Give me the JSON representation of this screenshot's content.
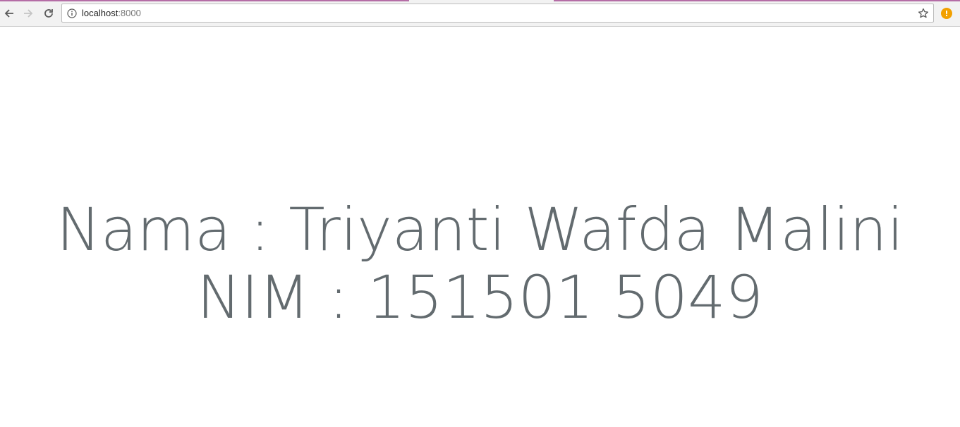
{
  "browser": {
    "url_host": "localhost",
    "url_port": ":8000",
    "accent_color": "#b56da6",
    "extension_badge": "!"
  },
  "page": {
    "name_line": "Nama : Triyanti Wafda Malini",
    "nim_line": "NIM : 151501 5049"
  }
}
